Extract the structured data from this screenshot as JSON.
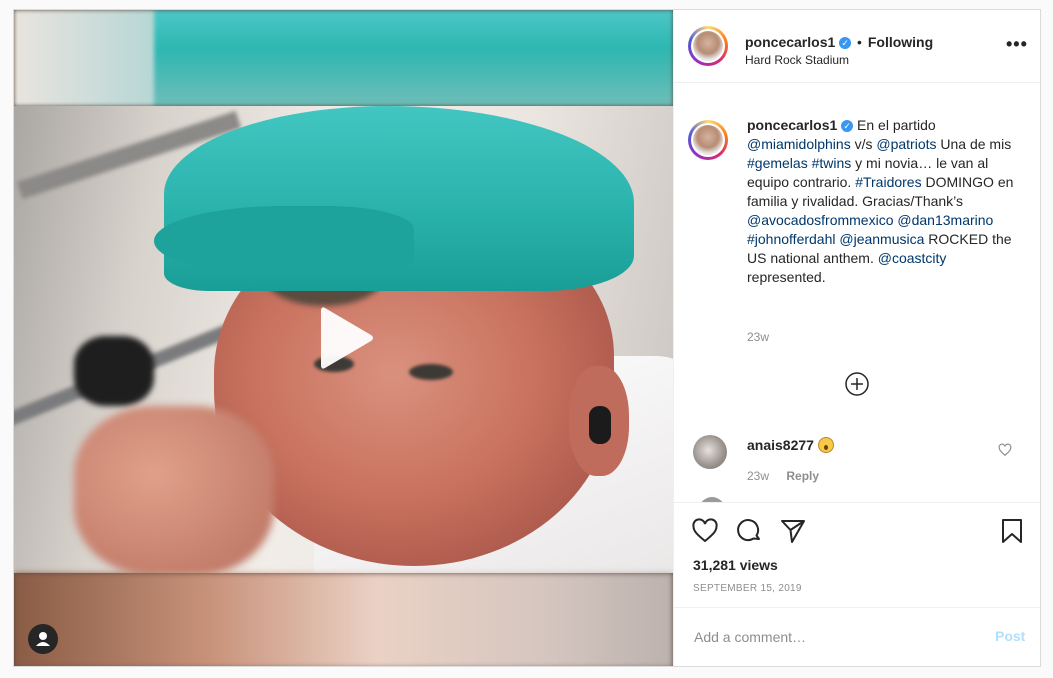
{
  "header": {
    "username": "poncecarlos1",
    "separator": "•",
    "follow_status": "Following",
    "location": "Hard Rock Stadium",
    "more_icon": "more-horizontal-icon"
  },
  "caption": {
    "username": "poncecarlos1",
    "segments": [
      {
        "text": "En el partido ",
        "link": false
      },
      {
        "text": "@miamidolphins",
        "link": true
      },
      {
        "text": " v/s ",
        "link": false
      },
      {
        "text": "@patriots",
        "link": true
      },
      {
        "text": " Una de mis ",
        "link": false
      },
      {
        "text": "#gemelas",
        "link": true
      },
      {
        "text": " ",
        "link": false
      },
      {
        "text": "#twins",
        "link": true
      },
      {
        "text": " y mi novia… le van al equipo contrario. ",
        "link": false
      },
      {
        "text": "#Traidores",
        "link": true
      },
      {
        "text": " DOMINGO en familia y rivalidad. Gracias/Thank’s ",
        "link": false
      },
      {
        "text": "@avocadosfrommexico",
        "link": true
      },
      {
        "text": " ",
        "link": false
      },
      {
        "text": "@dan13marino",
        "link": true
      },
      {
        "text": " ",
        "link": false
      },
      {
        "text": "#johnofferdahl",
        "link": true
      },
      {
        "text": " ",
        "link": false
      },
      {
        "text": "@jeanmusica",
        "link": true
      },
      {
        "text": " ROCKED the US national anthem. ",
        "link": false
      },
      {
        "text": "@coastcity",
        "link": true
      },
      {
        "text": " represented.",
        "link": false
      }
    ],
    "time_ago": "23w"
  },
  "comments": [
    {
      "username": "anais8277",
      "emoji": "astonished-face-emoji",
      "time_ago": "23w",
      "reply_label": "Reply"
    }
  ],
  "actions": {
    "icons": [
      "heart-icon",
      "comment-icon",
      "share-icon",
      "bookmark-icon"
    ],
    "views": "31,281 views",
    "date": "September 15, 2019"
  },
  "add_comment": {
    "placeholder": "Add a comment…",
    "post_label": "Post"
  },
  "colors": {
    "link": "#00376b",
    "verified": "#3897f0",
    "muted": "#8e8e8e",
    "post_disabled": "#b2dffc"
  }
}
